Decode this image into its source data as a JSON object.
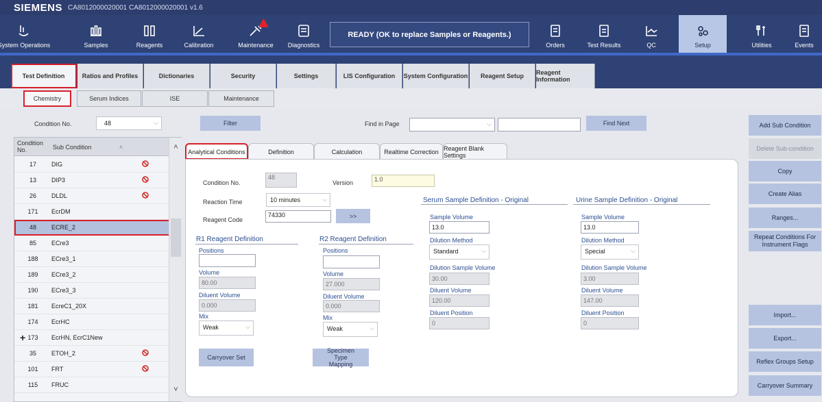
{
  "window": {
    "brand": "SIEMENS",
    "title": "CA8012000020001 CA8012000020001 v1.6"
  },
  "nav": {
    "items": [
      {
        "key": "system-operations",
        "label": "System Operations",
        "icon": "system-operations-icon"
      },
      {
        "key": "samples",
        "label": "Samples",
        "icon": "samples-icon"
      },
      {
        "key": "reagents",
        "label": "Reagents",
        "icon": "reagents-icon"
      },
      {
        "key": "calibration",
        "label": "Calibration",
        "icon": "calibration-icon"
      },
      {
        "key": "maintenance",
        "label": "Maintenance",
        "icon": "maintenance-icon"
      },
      {
        "key": "diagnostics",
        "label": "Diagnostics",
        "icon": "diagnostics-icon"
      },
      {
        "key": "orders",
        "label": "Orders",
        "icon": "orders-icon"
      },
      {
        "key": "test-results",
        "label": "Test Results",
        "icon": "test-results-icon"
      },
      {
        "key": "qc",
        "label": "QC",
        "icon": "qc-icon"
      },
      {
        "key": "setup",
        "label": "Setup",
        "icon": "setup-icon"
      },
      {
        "key": "utilities",
        "label": "Utilities",
        "icon": "utilities-icon"
      },
      {
        "key": "events",
        "label": "Events",
        "icon": "events-icon"
      }
    ],
    "active": "Setup",
    "status": "READY (OK to replace Samples or Reagents.)"
  },
  "main_tabs": [
    "Test Definition",
    "Ratios and Profiles",
    "Dictionaries",
    "Security",
    "Settings",
    "LIS Configuration",
    "System Configuration",
    "Reagent Setup",
    "Reagent Information"
  ],
  "sub_tabs": [
    "Chemistry",
    "Serum Indices",
    "ISE",
    "Maintenance"
  ],
  "filter_bar": {
    "condition_label": "Condition No.",
    "condition_value": "48",
    "filter_label": "Filter",
    "find_in_page_label": "Find in Page",
    "find_next_label": "Find Next"
  },
  "table": {
    "col_no": "Condition No.",
    "col_sub": "Sub Condition",
    "rows": [
      {
        "no": "17",
        "sub": "DIG",
        "blocked": true
      },
      {
        "no": "13",
        "sub": "DIP3",
        "blocked": true
      },
      {
        "no": "26",
        "sub": "DLDL",
        "blocked": true
      },
      {
        "no": "171",
        "sub": "EcrDM",
        "blocked": false
      },
      {
        "no": "48",
        "sub": "ECRE_2",
        "blocked": false,
        "selected": true
      },
      {
        "no": "85",
        "sub": "ECre3",
        "blocked": false
      },
      {
        "no": "188",
        "sub": "ECre3_1",
        "blocked": false
      },
      {
        "no": "189",
        "sub": "ECre3_2",
        "blocked": false
      },
      {
        "no": "190",
        "sub": "ECre3_3",
        "blocked": false
      },
      {
        "no": "181",
        "sub": "EcreC1_20X",
        "blocked": false
      },
      {
        "no": "174",
        "sub": "EcrHC",
        "blocked": false
      },
      {
        "no": "173",
        "sub": "EcrHN, EcrC1New",
        "blocked": false,
        "expandable": true
      },
      {
        "no": "35",
        "sub": "ETOH_2",
        "blocked": true
      },
      {
        "no": "101",
        "sub": "FRT",
        "blocked": true
      },
      {
        "no": "115",
        "sub": "FRUC",
        "blocked": false
      }
    ]
  },
  "inner_tabs": [
    "Analytical Conditions",
    "Definition",
    "Calculation",
    "Realtime Correction",
    "Reagent Blank Settings"
  ],
  "analytical": {
    "condition_no_label": "Condition No.",
    "condition_no_value": "48",
    "version_label": "Version",
    "version_value": "1.0",
    "reaction_time_label": "Reaction Time",
    "reaction_time_value": "10 minutes",
    "reagent_code_label": "Reagent Code",
    "reagent_code_value": "74330",
    "arrow_button": ">>",
    "r1": {
      "title": "R1 Reagent Definition",
      "positions_label": "Positions",
      "positions_value": "",
      "volume_label": "Volume",
      "volume_value": "80.00",
      "diluent_volume_label": "Diluent Volume",
      "diluent_volume_value": "0.000",
      "mix_label": "Mix",
      "mix_value": "Weak"
    },
    "r2": {
      "title": "R2 Reagent Definition",
      "positions_label": "Positions",
      "positions_value": "",
      "volume_label": "Volume",
      "volume_value": "27.000",
      "diluent_volume_label": "Diluent Volume",
      "diluent_volume_value": "0.000",
      "mix_label": "Mix",
      "mix_value": "Weak"
    },
    "serum": {
      "title": "Serum Sample Definition - Original",
      "sample_volume_label": "Sample Volume",
      "sample_volume_value": "13.0",
      "dilution_method_label": "Dilution Method",
      "dilution_method_value": "Standard",
      "dilution_sample_volume_label": "Dilution Sample Volume",
      "dilution_sample_volume_value": "30.00",
      "diluent_volume_label": "Diluent Volume",
      "diluent_volume_value": "120.00",
      "diluent_position_label": "Diluent Position",
      "diluent_position_value": "0"
    },
    "urine": {
      "title": "Urine Sample Definition - Original",
      "sample_volume_label": "Sample Volume",
      "sample_volume_value": "13.0",
      "dilution_method_label": "Dilution Method",
      "dilution_method_value": "Special",
      "dilution_sample_volume_label": "Dilution Sample Volume",
      "dilution_sample_volume_value": "3.00",
      "diluent_volume_label": "Diluent Volume",
      "diluent_volume_value": "147.00",
      "diluent_position_label": "Diluent Position",
      "diluent_position_value": "0"
    },
    "carryover_set": "Carryover Set",
    "specimen_type_mapping": "Specimen Type Mapping"
  },
  "right_buttons": [
    {
      "label": "Add Sub Condition",
      "disabled": false
    },
    {
      "label": "Delete Sub-condition",
      "disabled": true
    },
    {
      "label": "Copy",
      "disabled": false
    },
    {
      "label": "Create Alias",
      "disabled": false
    },
    {
      "label": "Ranges...",
      "disabled": false
    },
    {
      "label": "Repeat Conditions For Instrument Flags",
      "disabled": false
    },
    {
      "label": "Import...",
      "disabled": false
    },
    {
      "label": "Export...",
      "disabled": false
    },
    {
      "label": "Reflex Groups Setup",
      "disabled": false
    },
    {
      "label": "Carryover Summary",
      "disabled": false
    }
  ],
  "colors": {
    "nav_bg": "#2f4275",
    "accent": "#3f69c8",
    "highlight": "#d6202a",
    "selected_row": "#b3c1de"
  }
}
